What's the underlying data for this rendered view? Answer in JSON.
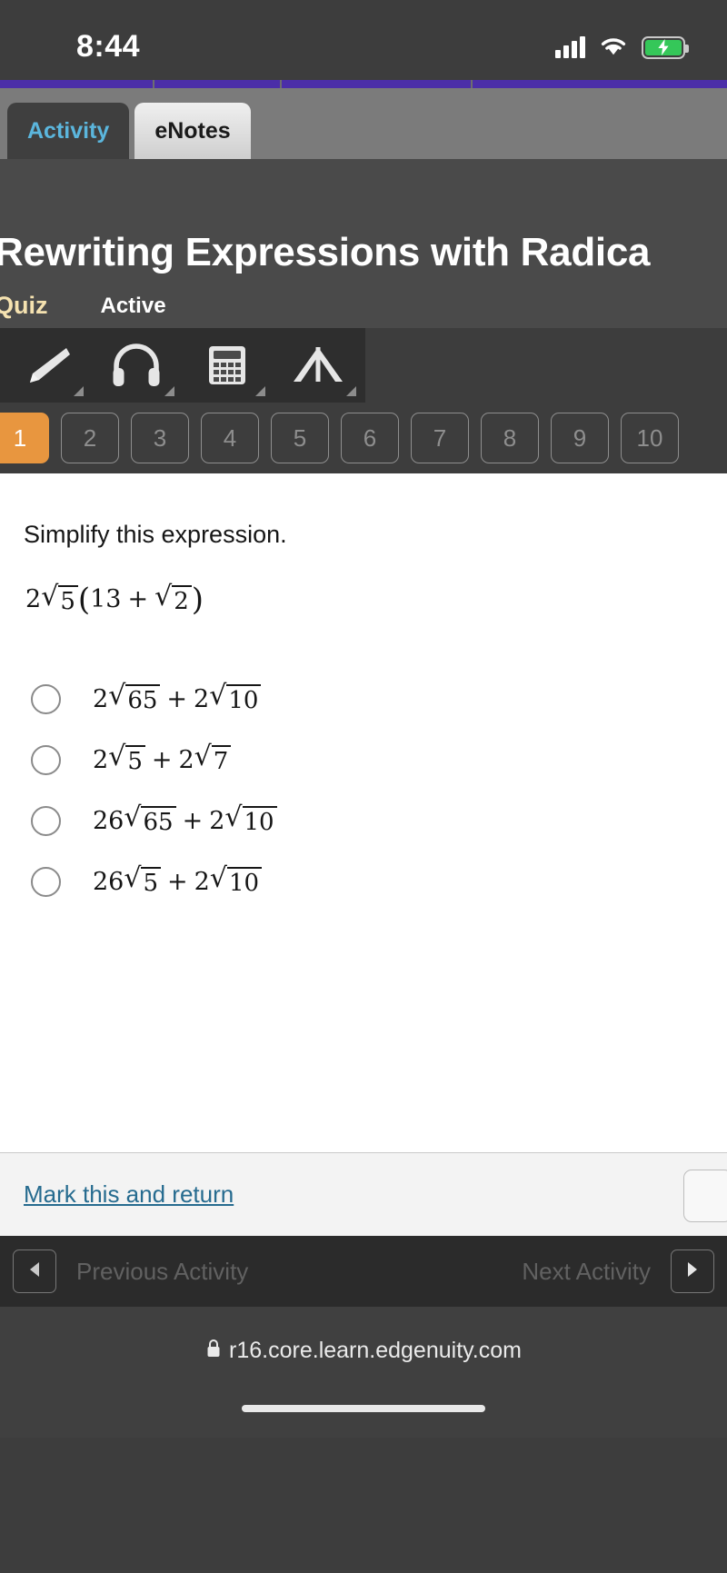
{
  "status_bar": {
    "time": "8:44",
    "signal_icon": "cellular-signal-icon",
    "wifi_icon": "wifi-icon",
    "battery_icon": "battery-charging-icon"
  },
  "browser_tabs": [
    {
      "label": "Activity",
      "active": true
    },
    {
      "label": "eNotes",
      "active": false
    }
  ],
  "lesson": {
    "title": "Rewriting Expressions with Radica",
    "type_label": "Quiz",
    "status_label": "Active"
  },
  "tools": [
    {
      "name": "highlighter-icon",
      "label": "Highlighter"
    },
    {
      "name": "headphones-icon",
      "label": "Read Aloud"
    },
    {
      "name": "calculator-icon",
      "label": "Calculator"
    },
    {
      "name": "protractor-icon",
      "label": "Math Tools"
    }
  ],
  "question_numbers": [
    {
      "label": "1",
      "current": true
    },
    {
      "label": "2",
      "current": false
    },
    {
      "label": "3",
      "current": false
    },
    {
      "label": "4",
      "current": false
    },
    {
      "label": "5",
      "current": false
    },
    {
      "label": "6",
      "current": false
    },
    {
      "label": "7",
      "current": false
    },
    {
      "label": "8",
      "current": false
    },
    {
      "label": "9",
      "current": false
    },
    {
      "label": "10",
      "current": false
    }
  ],
  "question": {
    "prompt": "Simplify this expression.",
    "expression": {
      "lead_coefficient": "2",
      "lead_radicand": "5",
      "open_paren": "(",
      "inner_term": "13",
      "inner_operator": "+",
      "inner_radicand": "2",
      "close_paren": ")",
      "plain_text": "2√5(13 + √2)"
    },
    "choices": [
      {
        "plain_text": "2√65 + 2√10",
        "c1": "2",
        "r1": "65",
        "op": "+",
        "c2": "2",
        "r2": "10",
        "selected": false
      },
      {
        "plain_text": "2√5 + 2√7",
        "c1": "2",
        "r1": "5",
        "op": "+",
        "c2": "2",
        "r2": "7",
        "selected": false
      },
      {
        "plain_text": "26√65 + 2√10",
        "c1": "26",
        "r1": "65",
        "op": "+",
        "c2": "2",
        "r2": "10",
        "selected": false
      },
      {
        "plain_text": "26√5 + 2√10",
        "c1": "26",
        "r1": "5",
        "op": "+",
        "c2": "2",
        "r2": "10",
        "selected": false
      }
    ]
  },
  "footer": {
    "mark_link": "Mark this and return",
    "save_button_icon": "save-button"
  },
  "activity_nav": {
    "prev_label": "Previous Activity",
    "next_label": "Next Activity",
    "prev_icon": "left-arrow-icon",
    "next_icon": "right-arrow-icon"
  },
  "address_bar": {
    "url": "r16.core.learn.edgenuity.com",
    "lock_icon": "lock-icon"
  },
  "colors": {
    "accent_orange": "#e8963f",
    "tab_active_text": "#5bb6dd",
    "link_blue": "#266b8f",
    "quiz_label": "#f5e2b0",
    "progress_purple": "#4b2ea8",
    "battery_green": "#35c759"
  }
}
